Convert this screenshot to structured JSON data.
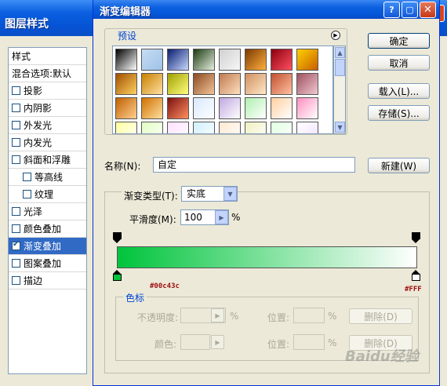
{
  "background_dialog": {
    "title": "图层样式",
    "styles_header": "样式",
    "items": [
      {
        "label": "混合选项:默认",
        "checkbox": false,
        "checked": false,
        "indent": false,
        "selected": false
      },
      {
        "label": "投影",
        "checkbox": true,
        "checked": false,
        "indent": false,
        "selected": false
      },
      {
        "label": "内阴影",
        "checkbox": true,
        "checked": false,
        "indent": false,
        "selected": false
      },
      {
        "label": "外发光",
        "checkbox": true,
        "checked": false,
        "indent": false,
        "selected": false
      },
      {
        "label": "内发光",
        "checkbox": true,
        "checked": false,
        "indent": false,
        "selected": false
      },
      {
        "label": "斜面和浮雕",
        "checkbox": true,
        "checked": false,
        "indent": false,
        "selected": false
      },
      {
        "label": "等高线",
        "checkbox": true,
        "checked": false,
        "indent": true,
        "selected": false
      },
      {
        "label": "纹理",
        "checkbox": true,
        "checked": false,
        "indent": true,
        "selected": false
      },
      {
        "label": "光泽",
        "checkbox": true,
        "checked": false,
        "indent": false,
        "selected": false
      },
      {
        "label": "颜色叠加",
        "checkbox": true,
        "checked": false,
        "indent": false,
        "selected": false
      },
      {
        "label": "渐变叠加",
        "checkbox": true,
        "checked": true,
        "indent": false,
        "selected": true
      },
      {
        "label": "图案叠加",
        "checkbox": true,
        "checked": false,
        "indent": false,
        "selected": false
      },
      {
        "label": "描边",
        "checkbox": true,
        "checked": false,
        "indent": false,
        "selected": false
      }
    ]
  },
  "editor": {
    "title": "渐变编辑器",
    "presets_label": "预设",
    "buttons": {
      "ok": "确定",
      "cancel": "取消",
      "load": "载入(L)...",
      "save": "存储(S)...",
      "new": "新建(W)"
    },
    "name_label": "名称(N):",
    "name_value": "自定",
    "gradient_type_label": "渐变类型(T):",
    "gradient_type_value": "实底",
    "smoothness_label": "平滑度(M):",
    "smoothness_value": "100",
    "smoothness_unit": "%",
    "gradient": {
      "start_color": "#00c43c",
      "end_color": "#ffffff",
      "start_hex_label": "#00c43c",
      "end_hex_label": "#FFF"
    },
    "stops_section": {
      "label": "色标",
      "opacity_label": "不透明度:",
      "opacity_unit": "%",
      "position_label_1": "位置:",
      "position_unit_1": "%",
      "delete_button_1": "删除(D)",
      "color_label": "颜色:",
      "position_label_2": "位置:",
      "position_unit_2": "%",
      "delete_button_2": "删除(D)"
    },
    "watermark": "Baidu经验"
  },
  "preset_swatches": [
    [
      "#000000",
      "#ffffff"
    ],
    [
      "#c6dcf3",
      "#9fc2e8"
    ],
    [
      "#0a1e6e",
      "#c8d8ff"
    ],
    [
      "#1a3a10",
      "#e8f0e0"
    ],
    [
      "#d0d0d0",
      "#f7f7f7"
    ],
    [
      "#7b3a00",
      "#ffb040"
    ],
    [
      "#8c0010",
      "#ff5060"
    ],
    [
      "#ffd000",
      "#c86000"
    ],
    [
      "#a05000",
      "#ffd060"
    ],
    [
      "#c88000",
      "#ffe0a0"
    ],
    [
      "#a0a000",
      "#ffff80"
    ],
    [
      "#8a4a20",
      "#f5c49a"
    ],
    [
      "#c07a50",
      "#ffe0c0"
    ],
    [
      "#d09060",
      "#ffe8c8"
    ],
    [
      "#c05030",
      "#ffc0a0"
    ],
    [
      "#a05060",
      "#f0c8d0"
    ],
    [
      "#c06000",
      "#ffd090"
    ],
    [
      "#d07000",
      "#ffe0a0"
    ],
    [
      "#7a1010",
      "#ff9060"
    ],
    [
      "#d8e8ff",
      "#ffffff"
    ],
    [
      "#c0a8e0",
      "#ffffff"
    ],
    [
      "#b0f0b0",
      "#ffffff"
    ],
    [
      "#ffd0a0",
      "#ffffff"
    ],
    [
      "#ff90c0",
      "#ffffff"
    ],
    [
      "#ffffa0",
      "#ffffff"
    ],
    [
      "#e0ffc0",
      "#ffffff"
    ],
    [
      "#ffe0ff",
      "#ffffff"
    ],
    [
      "#d0f0ff",
      "#ffffff"
    ],
    [
      "#ffe8d0",
      "#ffffff"
    ],
    [
      "#f0f0c0",
      "#ffffff"
    ],
    [
      "#e0ffe0",
      "#ffffff"
    ],
    [
      "#ffffff",
      "#f0e0ff"
    ]
  ],
  "icons": [
    "close-icon",
    "maximize-icon",
    "help-icon",
    "menu-arrow-icon",
    "scroll-up-icon",
    "scroll-down-icon",
    "dropdown-arrow-icon",
    "step-arrow-icon"
  ]
}
